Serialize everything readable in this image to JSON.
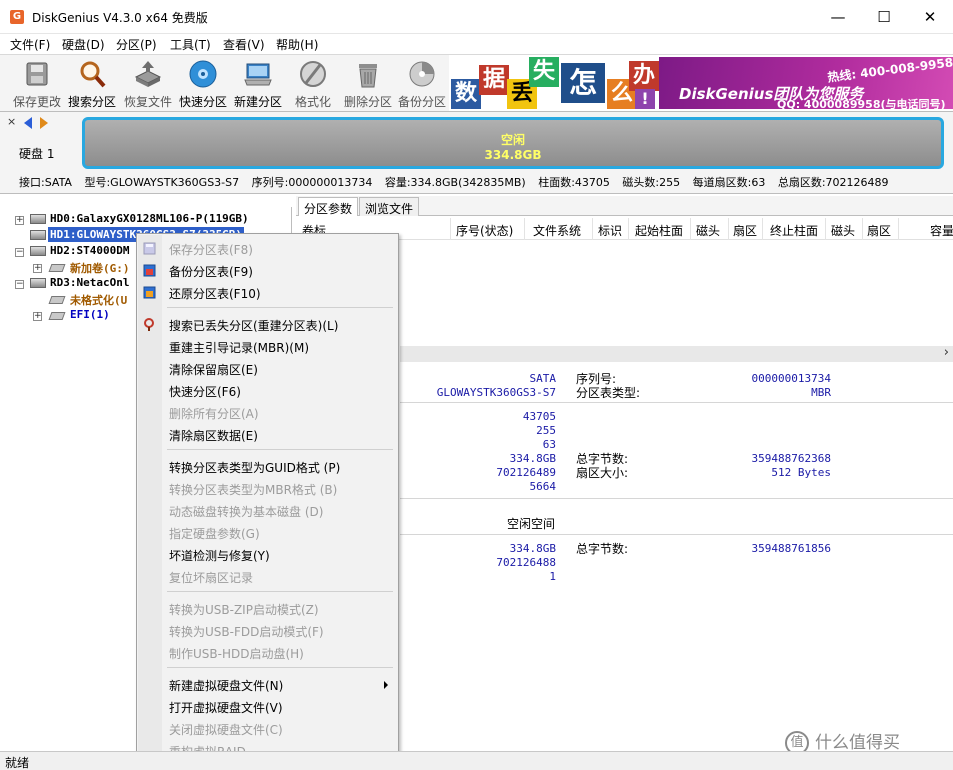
{
  "window": {
    "title": "DiskGenius V4.3.0 x64 免费版",
    "app_icon_letter": "G",
    "min": "—",
    "max": "☐",
    "close": "✕"
  },
  "menu": [
    "文件(F)",
    "硬盘(D)",
    "分区(P)",
    "工具(T)",
    "查看(V)",
    "帮助(H)"
  ],
  "toolbar": [
    {
      "label": "保存更改",
      "icon": "save-icon",
      "enabled": false
    },
    {
      "label": "搜索分区",
      "icon": "search-partition-icon",
      "enabled": true
    },
    {
      "label": "恢复文件",
      "icon": "recover-files-icon",
      "enabled": false
    },
    {
      "label": "快速分区",
      "icon": "quick-partition-icon",
      "enabled": true
    },
    {
      "label": "新建分区",
      "icon": "new-partition-icon",
      "enabled": true
    },
    {
      "label": "格式化",
      "icon": "format-icon",
      "enabled": false
    },
    {
      "label": "删除分区",
      "icon": "delete-partition-icon",
      "enabled": false
    },
    {
      "label": "备份分区",
      "icon": "backup-partition-icon",
      "enabled": false
    }
  ],
  "banner": {
    "tiles": [
      "数",
      "据",
      "丢",
      "失",
      "怎",
      "么",
      "办",
      "!"
    ],
    "brand": "DiskGenius团队为您服务",
    "hotline": "热线: 400-008-9958",
    "qq": "QQ: 4000089958(与电话同号)"
  },
  "disk": {
    "label": "硬盘 1",
    "partition_name": "空闲",
    "partition_size": "334.8GB",
    "info": {
      "interface": "接口:SATA",
      "model": "型号:GLOWAYSTK360GS3-S7",
      "serial": "序列号:000000013734",
      "capacity": "容量:334.8GB(342835MB)",
      "cylinders": "柱面数:43705",
      "heads": "磁头数:255",
      "sectors_per_track": "每道扇区数:63",
      "total_sectors": "总扇区数:702126489"
    }
  },
  "tree": [
    {
      "text": "HD0:GalaxyGX0128ML106-P(119GB)",
      "expander": "+",
      "kind": "disk",
      "color": "#000000"
    },
    {
      "text": "HD1:GLOWAYSTK360GS3-S7(335GB)",
      "expander": "",
      "kind": "disk",
      "color": "#ffffff",
      "selected": true
    },
    {
      "text": "HD2:ST4000DM",
      "expander": "−",
      "kind": "disk",
      "color": "#000000"
    },
    {
      "text": "新加卷(G:)",
      "expander": "+",
      "kind": "partition",
      "color": "#a05a00"
    },
    {
      "text": "RD3:NetacOnl",
      "expander": "−",
      "kind": "disk",
      "color": "#000000"
    },
    {
      "text": "未格式化(U",
      "expander": "",
      "kind": "partition",
      "color": "#a05a00"
    },
    {
      "text": "EFI(1)",
      "expander": "+",
      "kind": "partition",
      "color": "#0000c0"
    }
  ],
  "tabs": [
    "分区参数",
    "浏览文件"
  ],
  "columns": [
    "卷标",
    "序号(状态)",
    "文件系统",
    "标识",
    "起始柱面",
    "磁头",
    "扇区",
    "终止柱面",
    "磁头",
    "扇区",
    "容量"
  ],
  "details": {
    "interface_val": "SATA",
    "model_val": "GLOWAYSTK360GS3-S7",
    "serial_label": "序列号:",
    "serial_val": "000000013734",
    "pt_type_label": "分区表类型:",
    "pt_type_val": "MBR",
    "cylinders_val": "43705",
    "heads_val": "255",
    "sectors_val": "63",
    "capacity_val": "334.8GB",
    "total_bytes_label": "总字节数:",
    "total_bytes_val": "359488762368",
    "total_sectors_val": "702126489",
    "sector_size_label": "扇区大小:",
    "sector_size_val": "512 Bytes",
    "extra_val": "5664",
    "free_space_label": "空闲空间",
    "free_capacity_val": "334.8GB",
    "free_total_bytes_label": "总字节数:",
    "free_total_bytes_val": "359488761856",
    "free_sectors_val": "702126488",
    "free_start_val": "1"
  },
  "context_menu": [
    {
      "label": "保存分区表(F8)",
      "enabled": false,
      "icon": "save-table-icon"
    },
    {
      "label": "备份分区表(F9)",
      "enabled": true,
      "icon": "backup-table-icon"
    },
    {
      "label": "还原分区表(F10)",
      "enabled": true,
      "icon": "restore-table-icon"
    },
    {
      "sep": true
    },
    {
      "label": "搜索已丢失分区(重建分区表)(L)",
      "enabled": true,
      "icon": "search-lost-icon"
    },
    {
      "label": "重建主引导记录(MBR)(M)",
      "enabled": true
    },
    {
      "label": "清除保留扇区(E)",
      "enabled": true
    },
    {
      "label": "快速分区(F6)",
      "enabled": true
    },
    {
      "label": "删除所有分区(A)",
      "enabled": false
    },
    {
      "label": "清除扇区数据(E)",
      "enabled": true
    },
    {
      "sep": true
    },
    {
      "label": "转换分区表类型为GUID格式 (P)",
      "enabled": true
    },
    {
      "label": "转换分区表类型为MBR格式 (B)",
      "enabled": false
    },
    {
      "label": "动态磁盘转换为基本磁盘 (D)",
      "enabled": false
    },
    {
      "label": "指定硬盘参数(G)",
      "enabled": false
    },
    {
      "label": "坏道检测与修复(Y)",
      "enabled": true
    },
    {
      "label": "复位坏扇区记录",
      "enabled": false
    },
    {
      "sep": true
    },
    {
      "label": "转换为USB-ZIP启动模式(Z)",
      "enabled": false
    },
    {
      "label": "转换为USB-FDD启动模式(F)",
      "enabled": false
    },
    {
      "label": "制作USB-HDD启动盘(H)",
      "enabled": false
    },
    {
      "sep": true
    },
    {
      "label": "新建虚拟硬盘文件(N)",
      "enabled": true,
      "submenu": true
    },
    {
      "label": "打开虚拟硬盘文件(V)",
      "enabled": true
    },
    {
      "label": "关闭虚拟硬盘文件(C)",
      "enabled": false
    },
    {
      "label": "重构虚拟RAID",
      "enabled": false
    }
  ],
  "status": {
    "text": "就绪"
  },
  "watermark": {
    "glyph": "值",
    "text": "什么值得买"
  }
}
